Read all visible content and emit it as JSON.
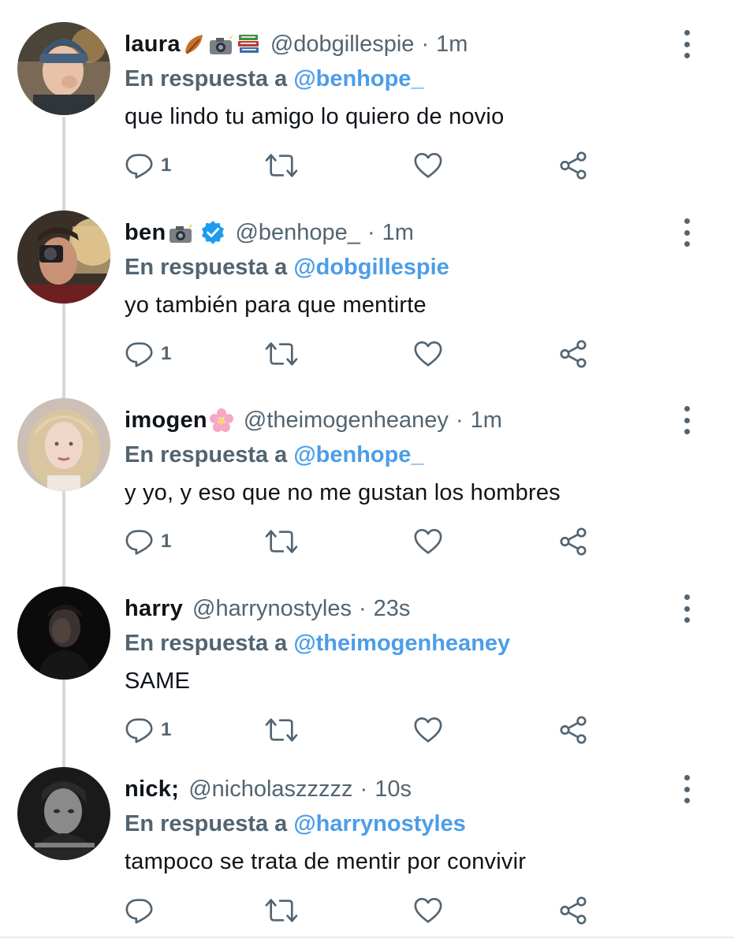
{
  "reply_prefix": "En respuesta a",
  "colors": {
    "text": "#0f1419",
    "muted": "#536471",
    "link": "#4c9de8",
    "verified": "#1d9bf0",
    "thread_line": "#cfd9de"
  },
  "tweets": [
    {
      "name": "laura",
      "name_emojis": [
        "leaf-emoji",
        "camera-flash-emoji",
        "books-emoji"
      ],
      "verified": false,
      "handle": "@dobgillespie",
      "separator": "·",
      "time": "1m",
      "mention": "@benhope_",
      "text": "que lindo tu amigo lo quiero de novio",
      "reply_count": "1"
    },
    {
      "name": "ben",
      "name_emojis": [
        "camera-flash-emoji"
      ],
      "verified": true,
      "handle": "@benhope_",
      "separator": "·",
      "time": "1m",
      "mention": "@dobgillespie",
      "text": "yo también para que mentirte",
      "reply_count": "1"
    },
    {
      "name": "imogen",
      "name_emojis": [
        "cherry-blossom-emoji"
      ],
      "verified": false,
      "handle": "@theimogenheaney",
      "separator": "·",
      "time": "1m",
      "mention": "@benhope_",
      "text": "y yo, y eso que no me gustan los hombres",
      "reply_count": "1"
    },
    {
      "name": "harry",
      "name_emojis": [],
      "verified": false,
      "handle": "@harrynostyles",
      "separator": "·",
      "time": "23s",
      "mention": "@theimogenheaney",
      "text": "SAME",
      "reply_count": "1"
    },
    {
      "name": "nick;",
      "name_emojis": [],
      "verified": false,
      "handle": "@nicholaszzzzz",
      "separator": "·",
      "time": "10s",
      "mention": "@harrynostyles",
      "text": "tampoco se trata de mentir por convivir",
      "reply_count": ""
    }
  ]
}
